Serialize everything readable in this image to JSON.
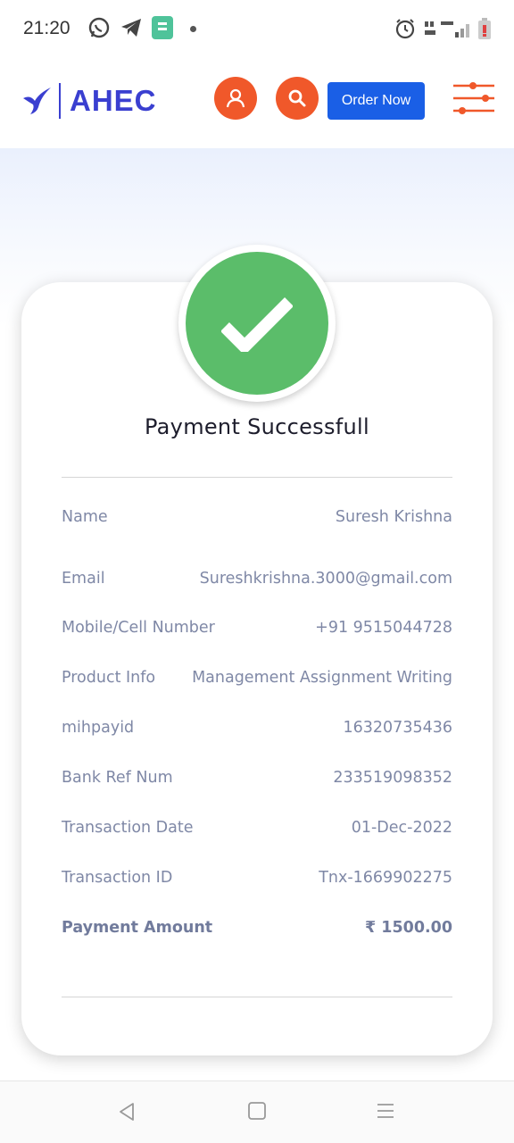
{
  "status_bar": {
    "time": "21:20",
    "icons": [
      "whatsapp-icon",
      "telegram-icon",
      "app-icon",
      "notification-dot",
      "alarm-icon",
      "volte-icon",
      "lte-signal-icon",
      "battery-icon"
    ]
  },
  "header": {
    "logo_text": "AHEC",
    "order_button_label": "Order Now",
    "icons": [
      "user-icon",
      "search-icon",
      "filter-icon"
    ],
    "colors": {
      "brand": "#3a3fd0",
      "accent": "#f0582a",
      "order": "#1a5fe6"
    }
  },
  "payment": {
    "title": "Payment Successfull",
    "check_color": "#5bbd6a",
    "rows": [
      {
        "label": "Name",
        "value": "Suresh Krishna"
      },
      {
        "label": "Email",
        "value": "Sureshkrishna.3000@gmail.com"
      },
      {
        "label": "Mobile/Cell Number",
        "value": "+91 9515044728"
      },
      {
        "label": "Product Info",
        "value": "Management Assignment Writing"
      },
      {
        "label": "mihpayid",
        "value": "16320735436"
      },
      {
        "label": "Bank Ref Num",
        "value": "233519098352"
      },
      {
        "label": "Transaction Date",
        "value": "01-Dec-2022"
      },
      {
        "label": "Transaction ID",
        "value": "Tnx-1669902275"
      },
      {
        "label": "Payment Amount",
        "value": "₹ 1500.00"
      }
    ]
  },
  "nav_bar": {
    "icons": [
      "back-icon",
      "home-icon",
      "menu-icon"
    ]
  }
}
